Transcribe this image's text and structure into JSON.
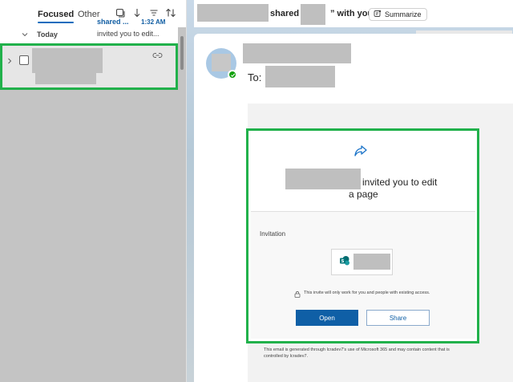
{
  "mail_list": {
    "tabs": [
      {
        "label": "Focused",
        "selected": true
      },
      {
        "label": "Other",
        "selected": false
      }
    ],
    "icons": [
      "select-all-icon",
      "jump-to-icon",
      "filter-icon",
      "sort-icon"
    ],
    "group_label": "Today",
    "message": {
      "subject_fragment": "shared ...",
      "time": "1:32 AM",
      "preview": "invited you to edit...",
      "has_link_attachment": true
    }
  },
  "reading_pane": {
    "title_part1": "shared “",
    "title_part2": "” with you",
    "summarize_label": "Summarize",
    "to_label": "To:",
    "invite": {
      "heading_part1": "invited you to edit",
      "heading_part2": "a page",
      "invitation_label": "Invitation",
      "access_note": "This invite will only work for you and people with existing access.",
      "open_label": "Open",
      "share_label": "Share"
    },
    "footer_note": "This email is generated through lcradev7's use of Microsoft 365 and may contain content that is controlled by lcradev7."
  },
  "colors": {
    "accent": "#0f6cbd",
    "highlight_outline": "#21b14b",
    "primary_button": "#0f5fa6",
    "presence_available": "#13a10e"
  }
}
